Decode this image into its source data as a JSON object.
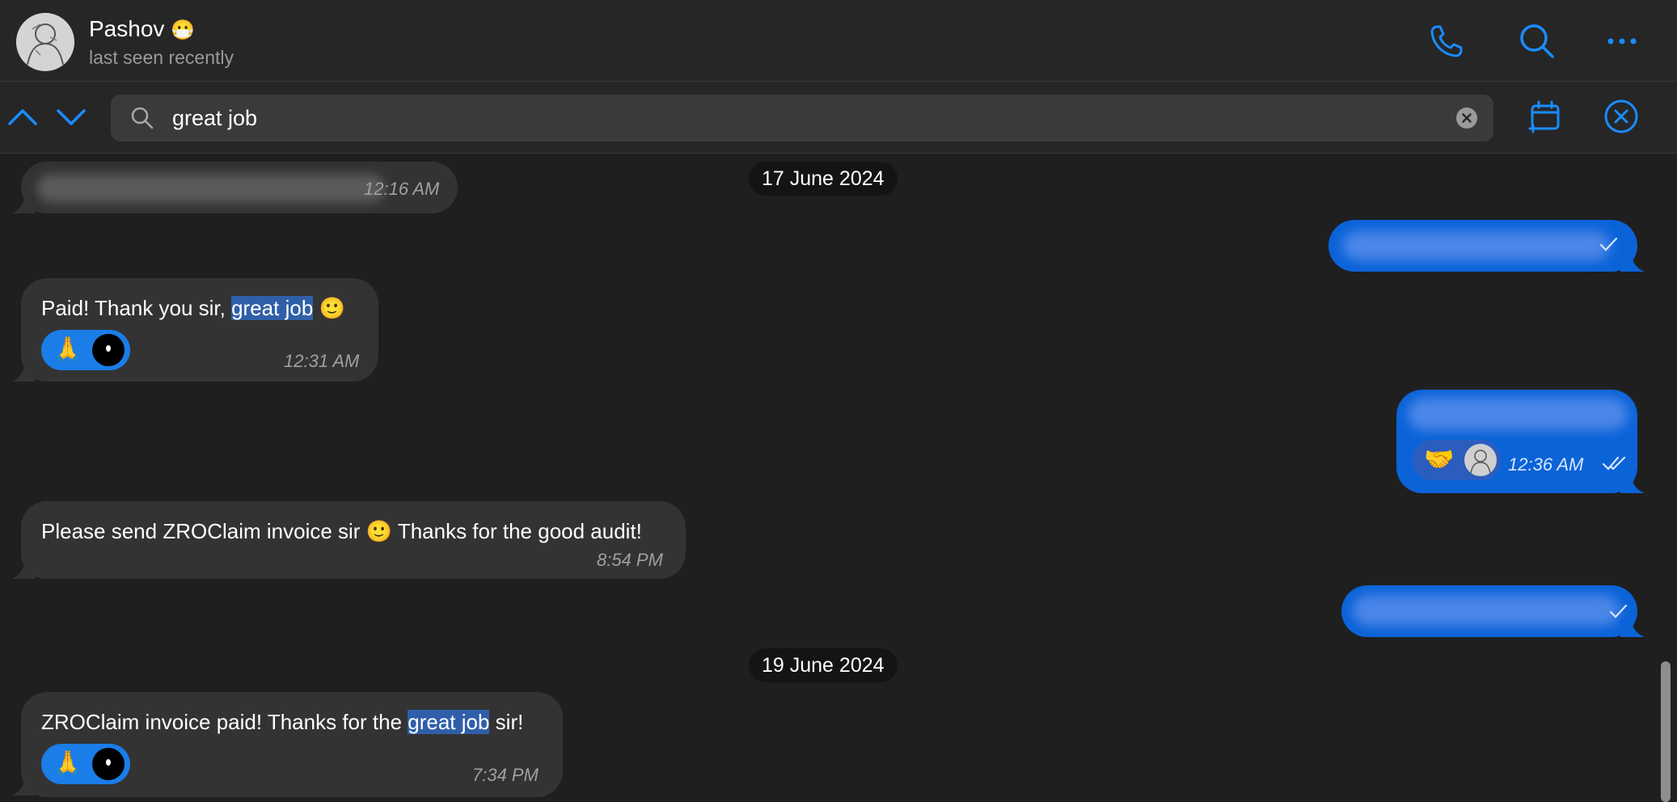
{
  "header": {
    "contact_name": "Pashov",
    "status": "last seen recently",
    "icons": [
      "face-mask-emoji",
      "phone-icon",
      "search-icon",
      "more-icon"
    ]
  },
  "search": {
    "value": "great job",
    "icons": [
      "chevron-up-icon",
      "chevron-down-icon",
      "search-icon",
      "clear-icon",
      "calendar-icon",
      "close-icon"
    ]
  },
  "chat": {
    "dates": [
      "17 June 2024",
      "19 June 2024"
    ],
    "messages": [
      {
        "direction": "in",
        "text_hidden": true,
        "time": "12:16 AM"
      },
      {
        "direction": "out",
        "text_hidden": true
      },
      {
        "direction": "in",
        "text_before": "Paid! Thank you sir, ",
        "highlight": "great job",
        "text_after": " 🙂",
        "reactions": [
          "🙏"
        ],
        "time": "12:31 AM"
      },
      {
        "direction": "out",
        "text_hidden": true,
        "reactions": [
          "🤝"
        ],
        "time": "12:36 AM"
      },
      {
        "direction": "in",
        "text": "Please send ZROClaim invoice sir 🙂 Thanks for the good audit!",
        "time": "8:54 PM"
      },
      {
        "direction": "out",
        "text_hidden": true
      },
      {
        "direction": "in",
        "text_before": "ZROClaim invoice paid! Thanks for the ",
        "highlight": "great job",
        "text_after": " sir!",
        "reactions": [
          "🙏"
        ],
        "time": "7:34 PM"
      }
    ]
  },
  "colors": {
    "background": "#1f1f1f",
    "incoming_bubble": "#333333",
    "outgoing_bubble": "#0b63d8",
    "accent": "#1a8cff",
    "highlight": "#2f5fa8"
  }
}
